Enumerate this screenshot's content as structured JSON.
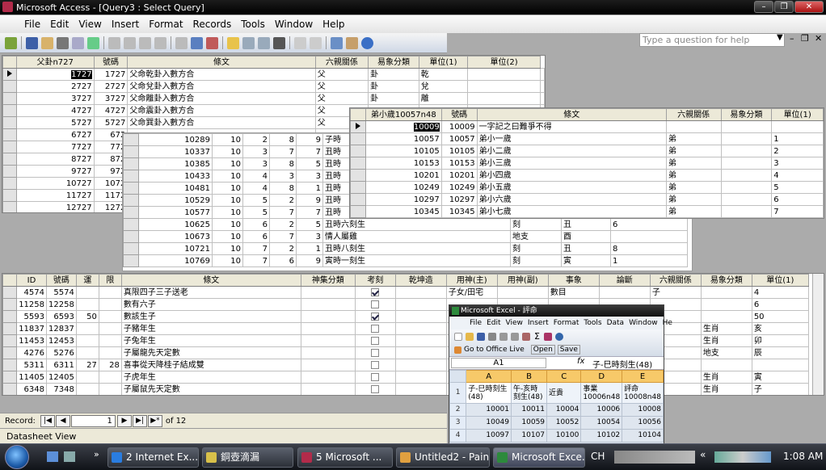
{
  "window": {
    "title": "Microsoft Access - [Query3 : Select Query]",
    "help_placeholder": "Type a question for help"
  },
  "menu": [
    "File",
    "Edit",
    "View",
    "Insert",
    "Format",
    "Records",
    "Tools",
    "Window",
    "Help"
  ],
  "q1": {
    "headers": [
      "父卦n727",
      "號碼",
      "條文",
      "六親關係",
      "易象分類",
      "單位(1)",
      "單位(2)"
    ],
    "rows": [
      [
        "1727",
        "1727",
        "父命乾卦入數方合",
        "父",
        "卦",
        "乾",
        ""
      ],
      [
        "2727",
        "2727",
        "父命兌卦入數方合",
        "父",
        "卦",
        "兌",
        ""
      ],
      [
        "3727",
        "3727",
        "父命離卦入數方合",
        "父",
        "卦",
        "離",
        ""
      ],
      [
        "4727",
        "4727",
        "父命震卦入數方合",
        "父",
        "",
        "",
        " "
      ],
      [
        "5727",
        "5727",
        "父命巽卦入數方合",
        "父",
        "",
        "",
        ""
      ],
      [
        "6727",
        "672",
        "",
        "",
        "",
        "",
        ""
      ],
      [
        "7727",
        "772",
        "",
        "",
        "",
        "",
        ""
      ],
      [
        "8727",
        "872",
        "",
        "",
        "",
        "",
        ""
      ],
      [
        "9727",
        "972",
        "",
        "",
        "",
        "",
        ""
      ],
      [
        "10727",
        "1072",
        "",
        "",
        "",
        "",
        ""
      ],
      [
        "11727",
        "1172",
        "",
        "",
        "",
        "",
        ""
      ],
      [
        "12727",
        "1272",
        "",
        "",
        "",
        "",
        ""
      ]
    ]
  },
  "q2": {
    "rows": [
      [
        "10289",
        "10",
        "2",
        "8",
        "9",
        "子時"
      ],
      [
        "10337",
        "10",
        "3",
        "7",
        "7",
        "丑時"
      ],
      [
        "10385",
        "10",
        "3",
        "8",
        "5",
        "丑時"
      ],
      [
        "10433",
        "10",
        "4",
        "3",
        "3",
        "丑時"
      ],
      [
        "10481",
        "10",
        "4",
        "8",
        "1",
        "丑時"
      ],
      [
        "10529",
        "10",
        "5",
        "2",
        "9",
        "丑時"
      ],
      [
        "10577",
        "10",
        "5",
        "7",
        "7",
        "丑時"
      ],
      [
        "10625",
        "10",
        "6",
        "2",
        "5",
        "丑時六刻生"
      ],
      [
        "10673",
        "10",
        "6",
        "7",
        "3",
        "情人屬雞"
      ],
      [
        "10721",
        "10",
        "7",
        "2",
        "1",
        "丑時八刻生"
      ],
      [
        "10769",
        "10",
        "7",
        "6",
        "9",
        "寅時一刻生"
      ]
    ],
    "extra": [
      [
        "刻",
        "丑",
        "6"
      ],
      [
        "地支",
        "酉",
        ""
      ],
      [
        "刻",
        "丑",
        "8"
      ],
      [
        "刻",
        "寅",
        "1"
      ]
    ]
  },
  "q3": {
    "headers": [
      "弟小歲10057n48",
      "號碼",
      "條文",
      "六親關係",
      "易象分類",
      "單位(1)"
    ],
    "rows": [
      [
        "10009",
        "10009",
        "一字記之曰難爭不得",
        "",
        "",
        ""
      ],
      [
        "10057",
        "10057",
        "弟小一歲",
        "弟",
        "",
        "1"
      ],
      [
        "10105",
        "10105",
        "弟小二歲",
        "弟",
        "",
        "2"
      ],
      [
        "10153",
        "10153",
        "弟小三歲",
        "弟",
        "",
        "3"
      ],
      [
        "10201",
        "10201",
        "弟小四歲",
        "弟",
        "",
        "4"
      ],
      [
        "10249",
        "10249",
        "弟小五歲",
        "弟",
        "",
        "5"
      ],
      [
        "10297",
        "10297",
        "弟小六歲",
        "弟",
        "",
        "6"
      ],
      [
        "10345",
        "10345",
        "弟小七歲",
        "弟",
        "",
        "7"
      ]
    ]
  },
  "q4": {
    "headers": [
      "ID",
      "號碼",
      "運",
      "限",
      "條文",
      "神集分類",
      "考刻",
      "乾坤造",
      "用神(主)",
      "用神(副)",
      "事象",
      "論斷",
      "六親關係",
      "易象分類",
      "單位(1)"
    ],
    "rows": [
      [
        "4574",
        "5574",
        "",
        "",
        "真限四子三子送老",
        "",
        true,
        "",
        "子女/田宅",
        "",
        "數目",
        "",
        "子",
        "",
        "4"
      ],
      [
        "11258",
        "12258",
        "",
        "",
        "數有六子",
        "",
        false,
        "",
        "",
        "",
        "",
        "",
        "",
        "",
        "6"
      ],
      [
        "5593",
        "6593",
        "50",
        "",
        "數該生子",
        "",
        true,
        "",
        "",
        "",
        "",
        "",
        "",
        "",
        "50"
      ],
      [
        "11837",
        "12837",
        "",
        "",
        "子豬年生",
        "",
        false,
        "",
        "",
        "",
        "",
        "",
        "",
        "生肖",
        "亥"
      ],
      [
        "11453",
        "12453",
        "",
        "",
        "子兔年生",
        "",
        false,
        "",
        "",
        "",
        "",
        "",
        "",
        "生肖",
        "卯"
      ],
      [
        "4276",
        "5276",
        "",
        "",
        "子屬龍先天定數",
        "",
        false,
        "",
        "",
        "",
        "",
        "",
        "",
        "地支",
        "辰"
      ],
      [
        "5311",
        "6311",
        "27",
        "28",
        "喜事從天降桂子結成雙",
        "",
        false,
        "",
        "",
        "",
        "",
        "",
        "",
        "",
        ""
      ],
      [
        "11405",
        "12405",
        "",
        "",
        "子虎年生",
        "",
        false,
        "",
        "",
        "",
        "",
        "",
        "",
        "生肖",
        "寅"
      ],
      [
        "6348",
        "7348",
        "",
        "",
        "子屬鼠先天定數",
        "",
        false,
        "",
        "",
        "",
        "",
        "",
        "",
        "生肖",
        "子"
      ]
    ]
  },
  "nav": {
    "label": "Record:",
    "current": "1",
    "of": "of",
    "total": "12"
  },
  "status": "Datasheet View",
  "excel": {
    "title": "Microsoft Excel - 評命",
    "menu": [
      "File",
      "Edit",
      "View",
      "Insert",
      "Format",
      "Tools",
      "Data",
      "Window",
      "He"
    ],
    "office_live": "Go to Office Live",
    "open": "Open",
    "save": "Save",
    "cell_ref": "A1",
    "formula": "子-巳時刻生(48)",
    "cols": [
      "A",
      "B",
      "C",
      "D",
      "E"
    ],
    "row1": [
      "子-巳時刻生(48)",
      "午-亥時刻生(48)",
      "近貴",
      "事業10006n48",
      "評命10008n48"
    ],
    "rows": [
      [
        "2",
        "10001",
        "10011",
        "10004",
        "10006",
        "10008"
      ],
      [
        "3",
        "10049",
        "10059",
        "10052",
        "10054",
        "10056"
      ],
      [
        "4",
        "10097",
        "10107",
        "10100",
        "10102",
        "10104"
      ]
    ]
  },
  "taskbar": {
    "items": [
      "2 Internet Ex...",
      "銅壺滴漏",
      "5 Microsoft ...",
      "Untitled2 - Paint",
      "Microsoft Exce..."
    ],
    "lang": "CH",
    "time": "1:08 AM"
  }
}
